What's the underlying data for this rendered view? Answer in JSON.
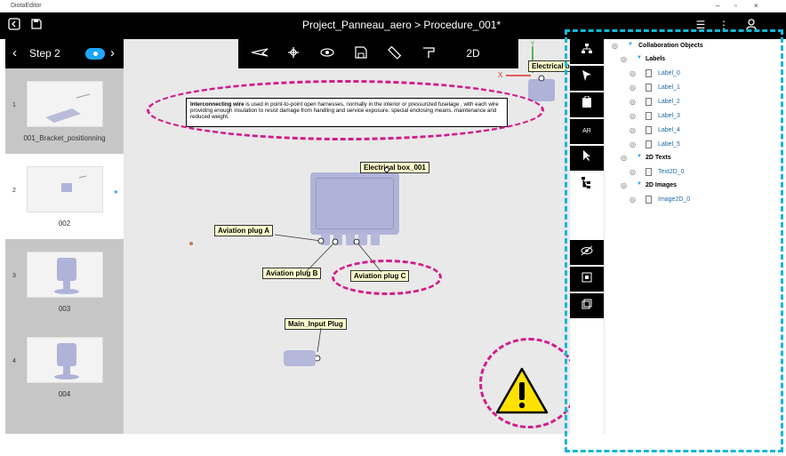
{
  "window": {
    "title": "DiotaEditor",
    "minimize": "–",
    "maximize": "▫",
    "close": "×"
  },
  "header": {
    "doc_title": "Project_Panneau_aero > Procedure_001*",
    "app_icon": "exit-icon",
    "save_icon": "save-icon",
    "right_icons": [
      "list-icon",
      "more-icon",
      "person-icon"
    ]
  },
  "steps": {
    "current_label": "Step 2",
    "prev_arrow": "‹",
    "next_arrow": "›",
    "items": [
      {
        "num": "1",
        "name": "001_Bracket_positionning"
      },
      {
        "num": "2",
        "name": "002"
      },
      {
        "num": "3",
        "name": "003"
      },
      {
        "num": "4",
        "name": "004"
      }
    ]
  },
  "toolbar": {
    "buttons": [
      "plane-icon",
      "gizmo-icon",
      "visibility-icon",
      "save-view-icon",
      "measure-icon",
      "paint-icon"
    ],
    "mode_2d": "2D"
  },
  "scene": {
    "info_text_bold": "Interconnecting wire",
    "info_text_rest": " is used in point-to-point open harnesses, normally in the interior or pressurized fuselage , with each wire providing enough insulation to resist damage from handling and service exposure. special enclosing means. maintenance and reduced weight.",
    "labels": {
      "electrical_box": "Electrical box_001",
      "electrical_box_top": "Electrical box",
      "plug_a": "Aviation plug A",
      "plug_b": "Aviation plug B",
      "plug_c": "Aviation plug C",
      "main_input": "Main_Input Plug"
    },
    "axis_y": "Y",
    "axis_x": "X"
  },
  "tools": {
    "items": [
      "hierarchy-icon",
      "cursor-icon",
      "clipboard-icon",
      "ar-icon",
      "pointer-icon",
      "tree-icon"
    ],
    "ar_label": "AR",
    "bottom_items": [
      "hide-icon",
      "frame-icon",
      "layers-icon"
    ]
  },
  "tree": {
    "root": "Collaboration Objects",
    "groups": [
      {
        "name": "Labels",
        "children": [
          "Label_0",
          "Label_1",
          "Label_2",
          "Label_3",
          "Label_4",
          "Label_5"
        ]
      },
      {
        "name": "2D Texts",
        "children": [
          "Text2D_0"
        ]
      },
      {
        "name": "2D Images",
        "children": [
          "Image2D_0"
        ]
      }
    ]
  },
  "colors": {
    "annotation_magenta": "#d11d8c",
    "annotation_cyan": "#13b8d8",
    "accent_blue": "#1ea7ff",
    "warning_yellow": "#ffe100"
  }
}
